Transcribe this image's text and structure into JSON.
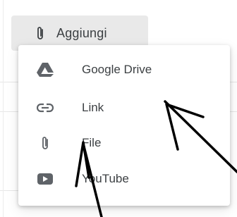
{
  "add_button": {
    "label": "Aggiungi",
    "icon": "paperclip-icon"
  },
  "menu": {
    "items": [
      {
        "label": "Google Drive",
        "icon": "google-drive-icon"
      },
      {
        "label": "Link",
        "icon": "link-icon"
      },
      {
        "label": "File",
        "icon": "paperclip-icon"
      },
      {
        "label": "YouTube",
        "icon": "youtube-icon"
      }
    ]
  },
  "colors": {
    "button_bg": "#e9e9e9",
    "text": "#3c4043",
    "icon": "#5f6368",
    "annotation": "#000000"
  }
}
